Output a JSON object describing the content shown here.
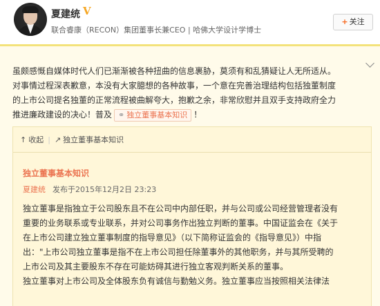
{
  "header": {
    "name": "夏建统",
    "verified_badge": "V",
    "bio": "联合睿康（RECON）集团董事长兼CEO | 哈佛大学设计学博士",
    "follow_label": "关注",
    "follow_plus": "+"
  },
  "post": {
    "lines": [
      "虽颇感慨自媒体时代人们已渐渐被各种扭曲的信息裹胁，莫须有和乱猜疑让人无所适从。",
      "对事情过程深表歉意，本没有大家臆想的各种故事，一个意在完善治理结构包括独董制度",
      "的上市公司提名独董的正常流程被曲解夸大，抱歉之余，非常欣慰并且双手支持政府全力"
    ],
    "last_line_prefix": "推进廉政建设的决心！普及",
    "link_label": "独立董事基本知识",
    "last_line_suffix": "！"
  },
  "article": {
    "toolbar": {
      "collapse_label": "收起",
      "source_label": "独立董事基本知识"
    },
    "title": "独立董事基本知识",
    "author": "夏建统",
    "published": "发布于2015年12月2日 23:23",
    "lines": [
      "独立董事是指独立于公司股东且不在公司中内部任职，并与公司或公司经营管理者没有",
      "重要的业务联系或专业联系，并对公司事务作出独立判断的董事。中国证监会在《关于",
      "在上市公司建立独立董事制度的指导意见》（以下简称证监会的《指导意见》）中指",
      "出：\"上市公司独立董事是指不在上市公司担任除董事外的其他职务，并与其所受聘的",
      "上市公司及其主要股东不存在可能妨碍其进行独立客观判断关系的董事。",
      "独立董事对上市公司及全体股东负有诚信与勤勉义务。独立董事应当按照相关法律法"
    ]
  },
  "colors": {
    "accent": "#eb7350",
    "verified": "#f5a623",
    "card_bg": "#fffbea"
  }
}
